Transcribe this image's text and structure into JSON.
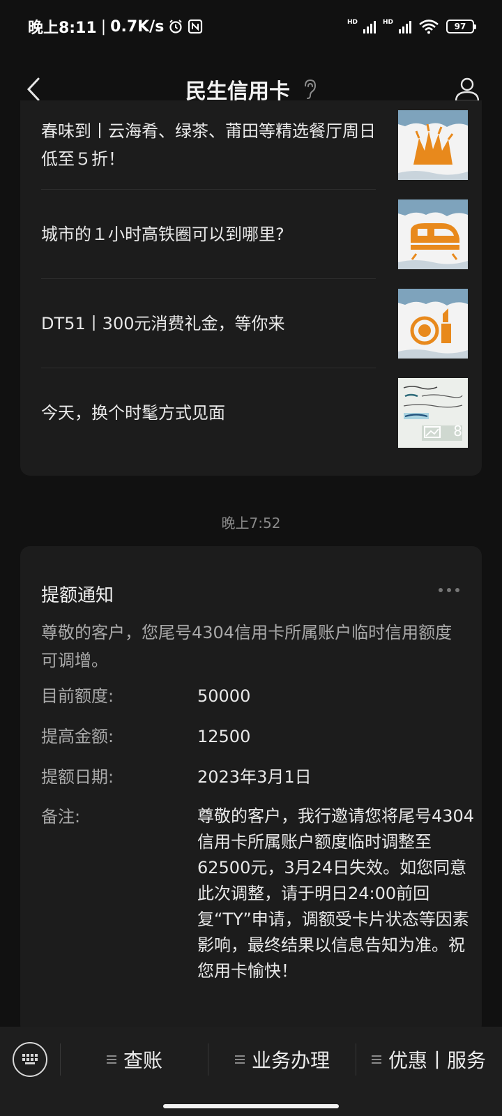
{
  "status_bar": {
    "time": "晚上8:11",
    "net_speed": "0.7K/s",
    "hd_1": "HD",
    "hd_2": "HD",
    "battery": "97"
  },
  "header": {
    "title": "民生信用卡"
  },
  "articles": [
    {
      "title": "春味到丨云海肴、绿茶、莆田等精选餐厅周日低至５折！",
      "thumb_icon": "dining-icon"
    },
    {
      "title": "城市的１小时高铁圈可以到哪里?",
      "thumb_icon": "train-icon"
    },
    {
      "title": "DT51丨300元消费礼金，等你来",
      "thumb_icon": "cosmetics-icon"
    },
    {
      "title": "今天，换个时髦方式见面",
      "thumb_icon": "handwritten-note-image",
      "thumb_count": "8"
    }
  ],
  "timestamp": "晚上7:52",
  "notice": {
    "title": "提额通知",
    "intro": "尊敬的客户，您尾号4304信用卡所属账户临时信用额度可调增。",
    "fields": [
      {
        "label": "目前额度:",
        "value": "50000"
      },
      {
        "label": "提高金额:",
        "value": "12500"
      },
      {
        "label": "提额日期:",
        "value": "2023年3月1日"
      },
      {
        "label": "备注:",
        "value": "尊敬的客户，我行邀请您将尾号4304信用卡所属账户额度临时调整至62500元，3月24日失效。如您同意此次调整，请于明日24:00前回复“TY”申请，调额受卡片状态等因素影响，最终结果以信息告知为准。祝您用卡愉快！"
      }
    ]
  },
  "bottom_nav": {
    "items": [
      {
        "label": "查账"
      },
      {
        "label": "业务办理"
      },
      {
        "label": "优惠丨服务"
      }
    ]
  },
  "colors": {
    "background": "#111111",
    "card": "#1c1c1c",
    "accent_orange": "#e8891c",
    "thumb_bg": "#f3f3f3"
  }
}
